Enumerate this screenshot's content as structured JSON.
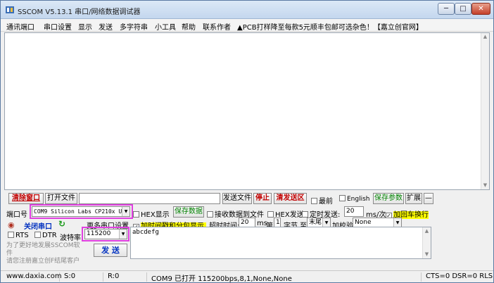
{
  "window": {
    "title": "SSCOM V5.13.1 串口/网络数据调试器",
    "minimize": "─",
    "maximize": "□",
    "close": "✕"
  },
  "menu": {
    "items": [
      "通讯端口",
      "串口设置",
      "显示",
      "发送",
      "多字符串",
      "小工具",
      "帮助",
      "联系作者",
      "▲PCB打样降至每款5元顺丰包邮可选杂色！【嘉立创官网】"
    ]
  },
  "toolbar": {
    "clear_window": "清除窗口",
    "open_file": "打开文件",
    "file_path": "",
    "send_file": "发送文件",
    "stop": "停止",
    "clear_send": "清发送区",
    "topmost": "最前",
    "english": "English",
    "save_params": "保存参数",
    "expand": "扩展",
    "collapse": "—"
  },
  "port": {
    "port_label": "端口号",
    "port_value": "COM9 Silicon Labs CP210x U",
    "hex_display": "HEX显示",
    "save_data": "保存数据",
    "recv_to_file": "接收数据到文件",
    "hex_send": "HEX发送",
    "timed_send": "定时发送:",
    "timed_value": "20",
    "ms_per": "ms/次",
    "crlf": "加回车换行",
    "close_port": "关闭串口",
    "more_settings": "更多串口设置",
    "timestamp": "加时间戳和分包显示,",
    "timeout_label": "超时时间:",
    "timeout_value": "20",
    "ms": "ms",
    "byte_prefix": "第",
    "byte_value": "1",
    "byte_suffix": "字节 至",
    "end_value": "末尾",
    "checksum_label": "加校验",
    "checksum_value": "None",
    "rts": "RTS",
    "dtr": "DTR",
    "baud_label": "波特率",
    "baud_value": "115200",
    "promo": "为了更好地发展SSCOM软件\n请您注册嘉立创F结尾客户",
    "send": "发 送",
    "send_text": "abcdefg"
  },
  "status": {
    "website": "www.daxia.com",
    "sent": "S:0",
    "received": "R:0",
    "port_state": "COM9 已打开  115200bps,8,1,None,None",
    "lines": "CTS=0 DSR=0 RLS"
  },
  "colors": {
    "highlight_box": "#e040e0",
    "red_text": "#c00000",
    "green_text": "#008000",
    "yellow_bg": "#ffff00"
  }
}
